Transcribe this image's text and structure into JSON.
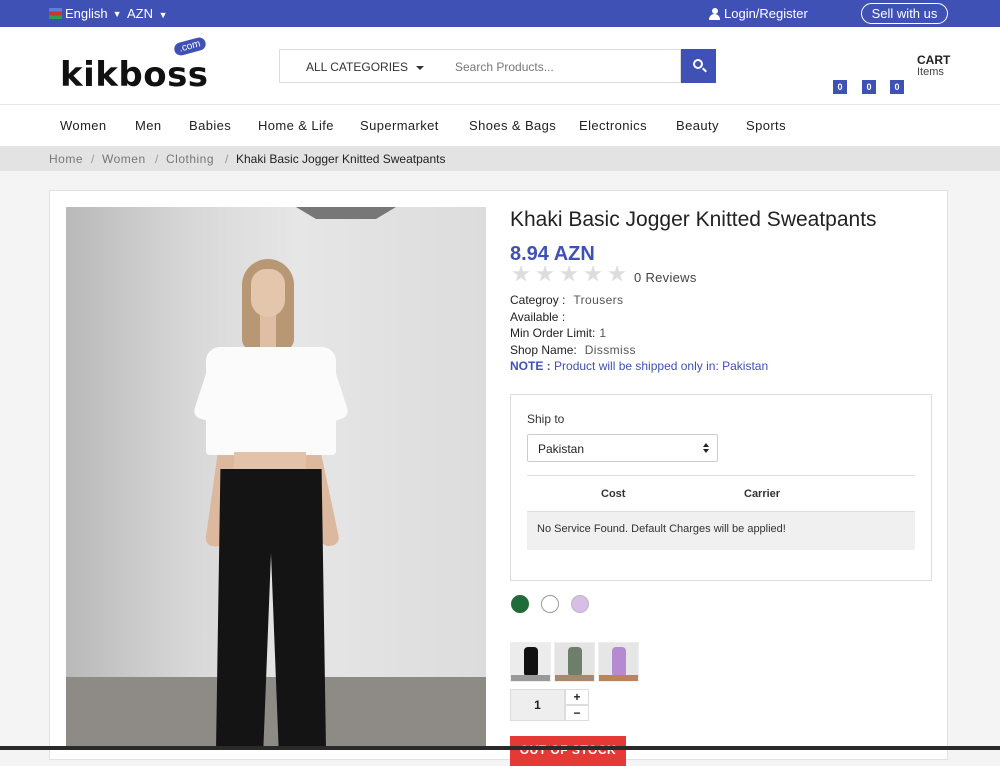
{
  "topbar": {
    "language": "English",
    "currency": "AZN",
    "login_label": "Login/Register",
    "sell_label": "Sell with us"
  },
  "header": {
    "logo_text": "kikboss",
    "logo_suffix": ".com",
    "category_label": "ALL CATEGORIES",
    "search_placeholder": "Search Products...",
    "cart_title": "CART",
    "cart_sub": "Items",
    "badges": [
      "0",
      "0",
      "0"
    ]
  },
  "nav": [
    "Women",
    "Men",
    "Babies",
    "Home & Life",
    "Supermarket",
    "Shoes & Bags",
    "Electronics",
    "Beauty",
    "Sports"
  ],
  "breadcrumb": {
    "items": [
      "Home",
      "Women",
      "Clothing"
    ],
    "separator": "/",
    "current": "Khaki Basic Jogger Knitted Sweatpants"
  },
  "product": {
    "title": "Khaki Basic Jogger Knitted Sweatpants",
    "price": "8.94 AZN",
    "rating": 0,
    "reviews": "0 Reviews",
    "category_label": "Categroy :",
    "category_value": "Trousers",
    "available_label": "Available :",
    "available_value": "",
    "min_order_label": "Min Order Limit:",
    "min_order_value": "1",
    "shop_label": "Shop Name:",
    "shop_value": "Dissmiss",
    "note_label": "NOTE :",
    "note_text": "Product will be shipped only in: Pakistan"
  },
  "shipping": {
    "label": "Ship to",
    "selected_country": "Pakistan",
    "col_cost": "Cost",
    "col_carrier": "Carrier",
    "message": "No Service Found. Default Charges will be applied!"
  },
  "colors": [
    "#1f6b3a",
    "#ffffff",
    "#d8bde8"
  ],
  "quantity": {
    "value": "1",
    "plus": "+",
    "minus": "−"
  },
  "stock_button": "OUT OF STOCK"
}
